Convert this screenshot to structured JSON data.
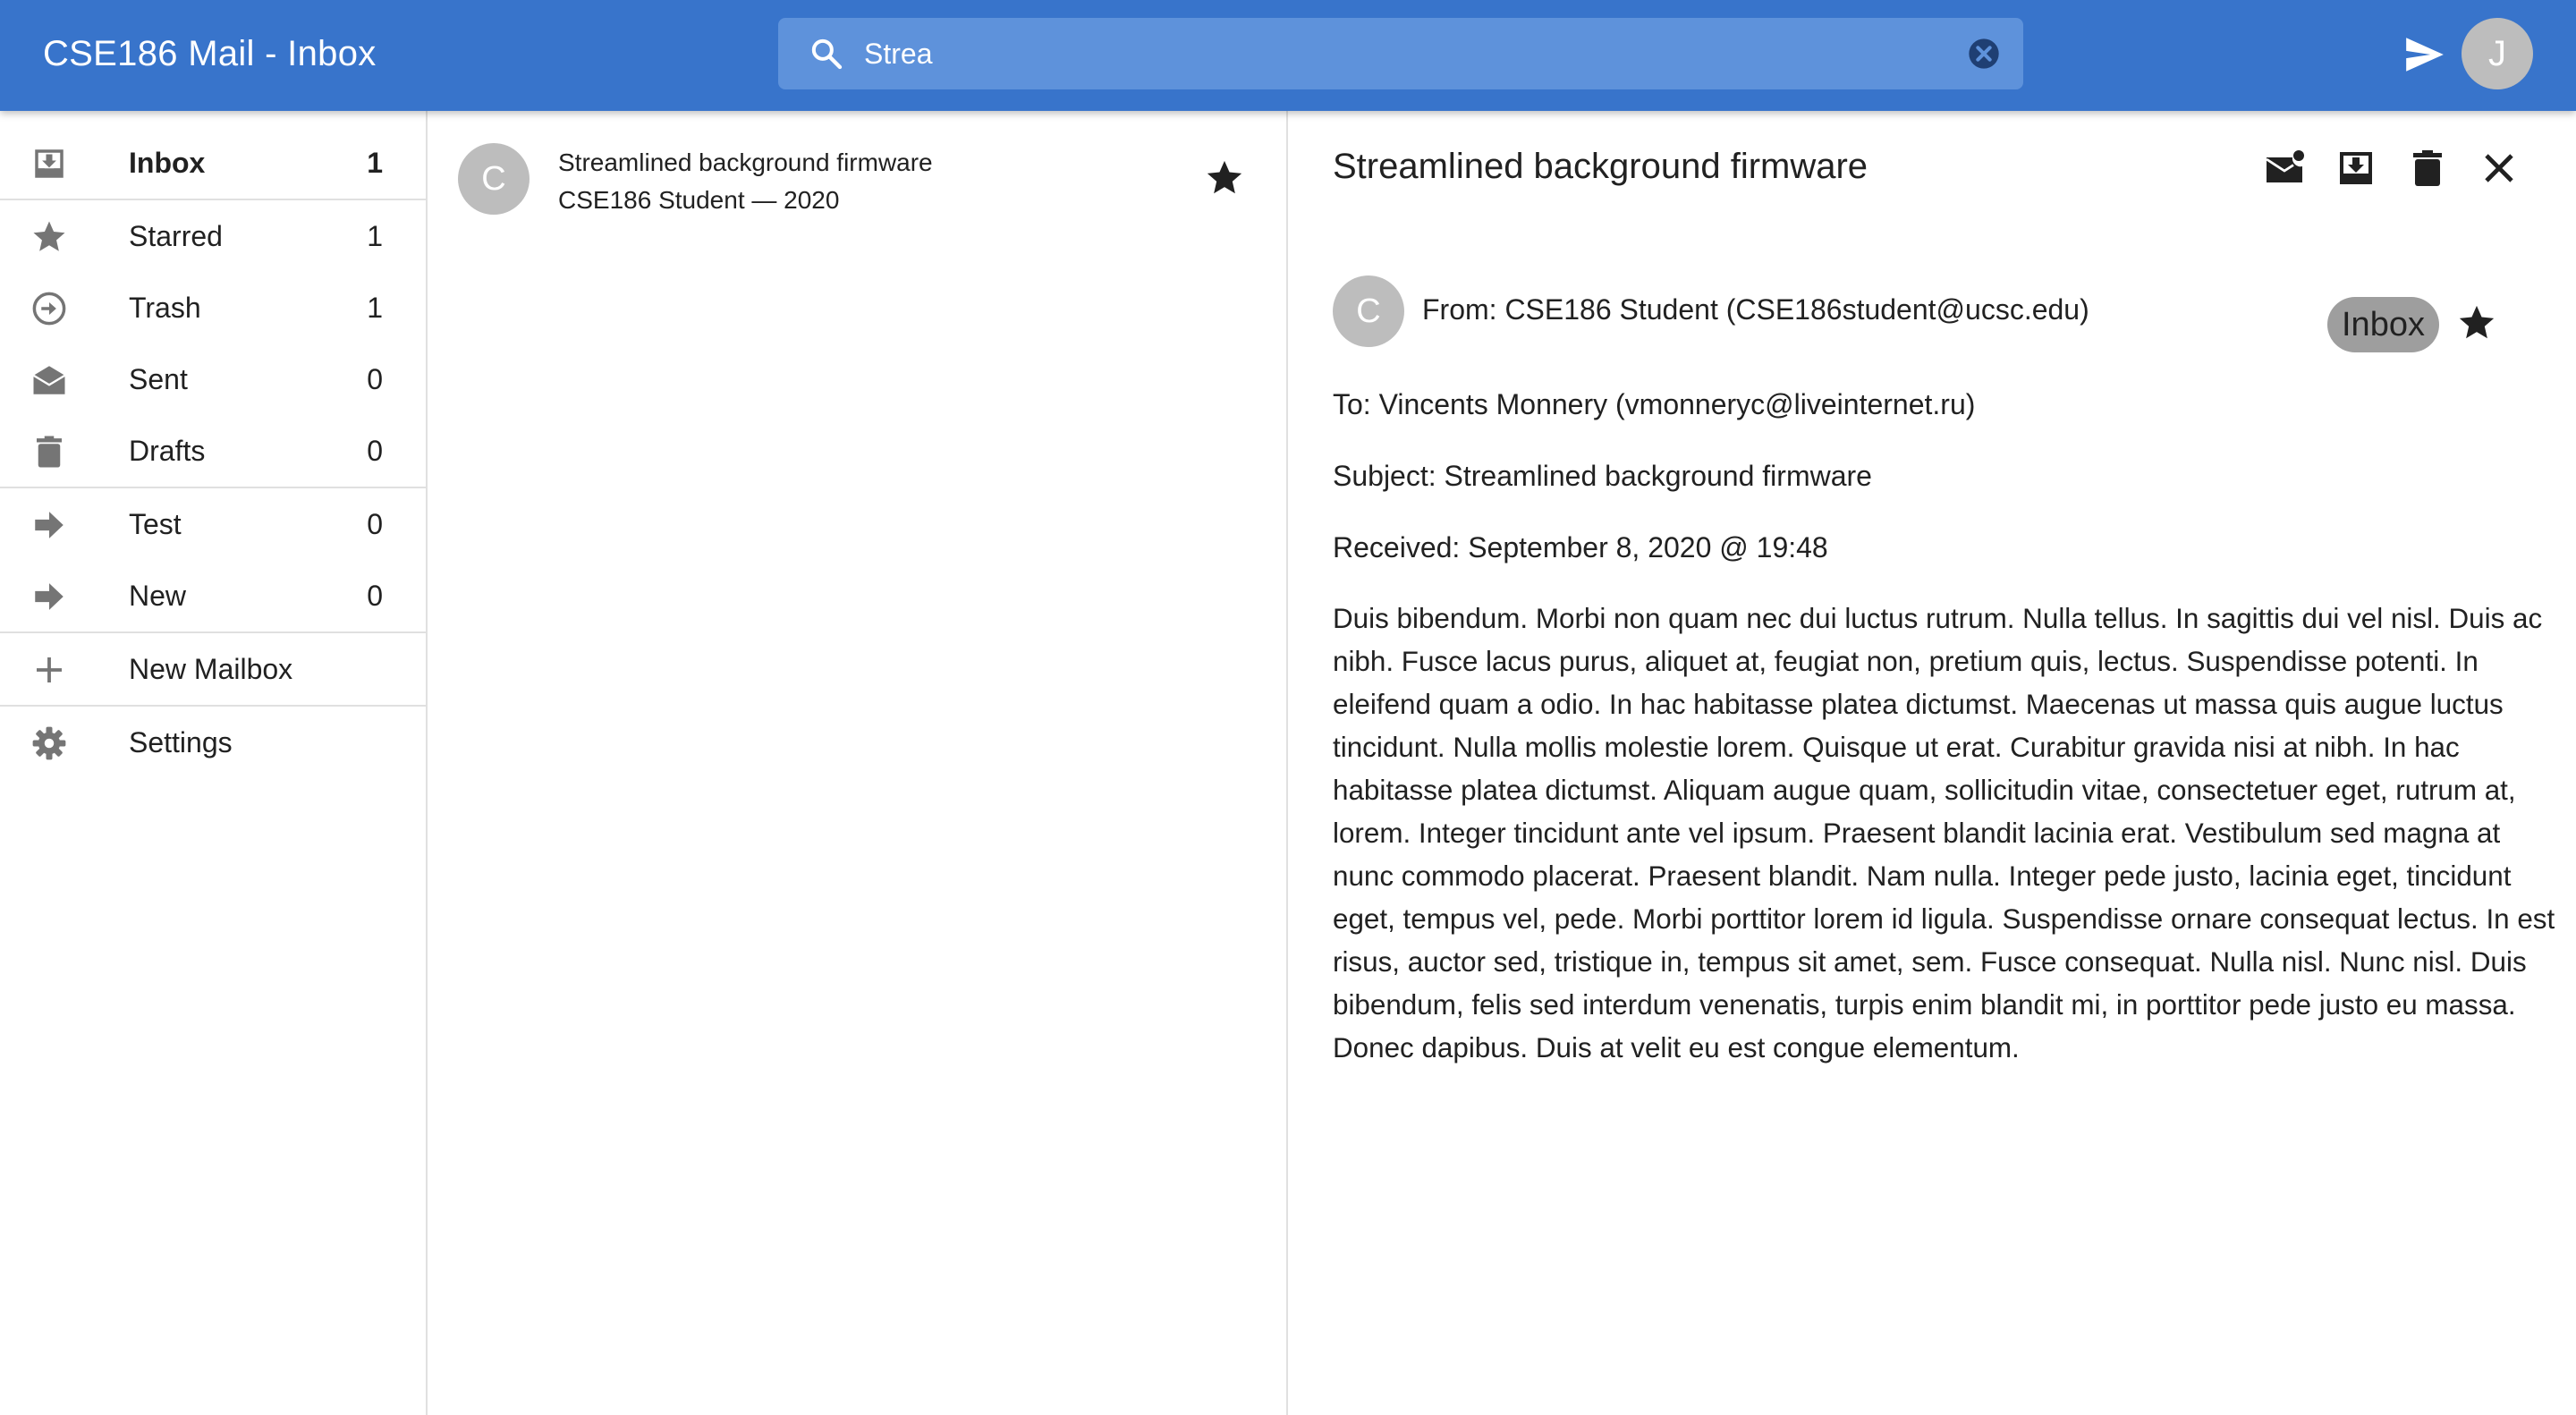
{
  "header": {
    "title": "CSE186 Mail - Inbox",
    "search_value": "Strea",
    "avatar_letter": "J",
    "bar_color": "#3874cb"
  },
  "sidebar": {
    "items": [
      {
        "label": "Inbox",
        "count": "1",
        "icon": "inbox-icon",
        "active": true
      },
      {
        "label": "Starred",
        "count": "1",
        "icon": "star-icon"
      },
      {
        "label": "Trash",
        "count": "1",
        "icon": "trash-circle-icon"
      },
      {
        "label": "Sent",
        "count": "0",
        "icon": "open-mail-icon"
      },
      {
        "label": "Drafts",
        "count": "0",
        "icon": "delete-icon"
      },
      {
        "label": "Test",
        "count": "0",
        "icon": "arrow-right-icon"
      },
      {
        "label": "New",
        "count": "0",
        "icon": "arrow-right-icon"
      },
      {
        "label": "New Mailbox",
        "icon": "plus-icon"
      },
      {
        "label": "Settings",
        "icon": "gear-icon"
      }
    ]
  },
  "list": {
    "items": [
      {
        "avatar_letter": "C",
        "subject": "Streamlined background firmware",
        "meta": "CSE186 Student — 2020",
        "starred": true
      }
    ]
  },
  "reader": {
    "title": "Streamlined background firmware",
    "avatar_letter": "C",
    "from": "From: CSE186 Student (CSE186student@ucsc.edu)",
    "mailbox_chip": "Inbox",
    "to": "To: Vincents Monnery (vmonneryc@liveinternet.ru)",
    "subject": "Subject: Streamlined background firmware",
    "received": "Received: September 8, 2020 @ 19:48",
    "body": "Duis bibendum. Morbi non quam nec dui luctus rutrum. Nulla tellus. In sagittis dui vel nisl. Duis ac nibh. Fusce lacus purus, aliquet at, feugiat non, pretium quis, lectus. Suspendisse potenti. In eleifend quam a odio. In hac habitasse platea dictumst. Maecenas ut massa quis augue luctus tincidunt. Nulla mollis molestie lorem. Quisque ut erat. Curabitur gravida nisi at nibh. In hac habitasse platea dictumst. Aliquam augue quam, sollicitudin vitae, consectetuer eget, rutrum at, lorem. Integer tincidunt ante vel ipsum. Praesent blandit lacinia erat. Vestibulum sed magna at nunc commodo placerat. Praesent blandit. Nam nulla. Integer pede justo, lacinia eget, tincidunt eget, tempus vel, pede. Morbi porttitor lorem id ligula. Suspendisse ornare consequat lectus. In est risus, auctor sed, tristique in, tempus sit amet, sem. Fusce consequat. Nulla nisl. Nunc nisl. Duis bibendum, felis sed interdum venenatis, turpis enim blandit mi, in porttitor pede justo eu massa. Donec dapibus. Duis at velit eu est congue elementum."
  }
}
